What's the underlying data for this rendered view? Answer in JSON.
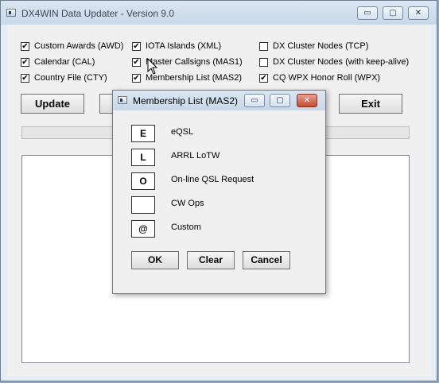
{
  "window": {
    "title": "DX4WIN Data Updater - Version 9.0",
    "controls": {
      "minimize": "▭",
      "maximize": "▢",
      "close": "✕"
    }
  },
  "checkboxes": [
    {
      "label": "Custom Awards (AWD)",
      "checked": true
    },
    {
      "label": "IOTA Islands (XML)",
      "checked": true
    },
    {
      "label": "DX Cluster Nodes (TCP)",
      "checked": false
    },
    {
      "label": "Calendar (CAL)",
      "checked": true
    },
    {
      "label": "Master Callsigns (MAS1)",
      "checked": true
    },
    {
      "label": "DX Cluster Nodes (with keep-alive)",
      "checked": false
    },
    {
      "label": "Country File (CTY)",
      "checked": true
    },
    {
      "label": "Membership List (MAS2)",
      "checked": true
    },
    {
      "label": "CQ WPX Honor Roll (WPX)",
      "checked": true
    }
  ],
  "buttons": {
    "update": "Update",
    "exit": "Exit"
  },
  "dialog": {
    "title": "Membership List (MAS2)",
    "controls": {
      "minimize": "▭",
      "maximize": "▢",
      "close": "✕"
    },
    "codes": [
      {
        "code": "E",
        "label": "eQSL"
      },
      {
        "code": "L",
        "label": "ARRL LoTW"
      },
      {
        "code": "O",
        "label": "On-line QSL Request"
      },
      {
        "code": "",
        "label": "CW Ops"
      },
      {
        "code": "@",
        "label": "Custom"
      }
    ],
    "buttons": {
      "ok": "OK",
      "clear": "Clear",
      "cancel": "Cancel"
    }
  },
  "icons": {
    "checkmark": "✔",
    "cursor": "mouse-pointer-icon"
  }
}
